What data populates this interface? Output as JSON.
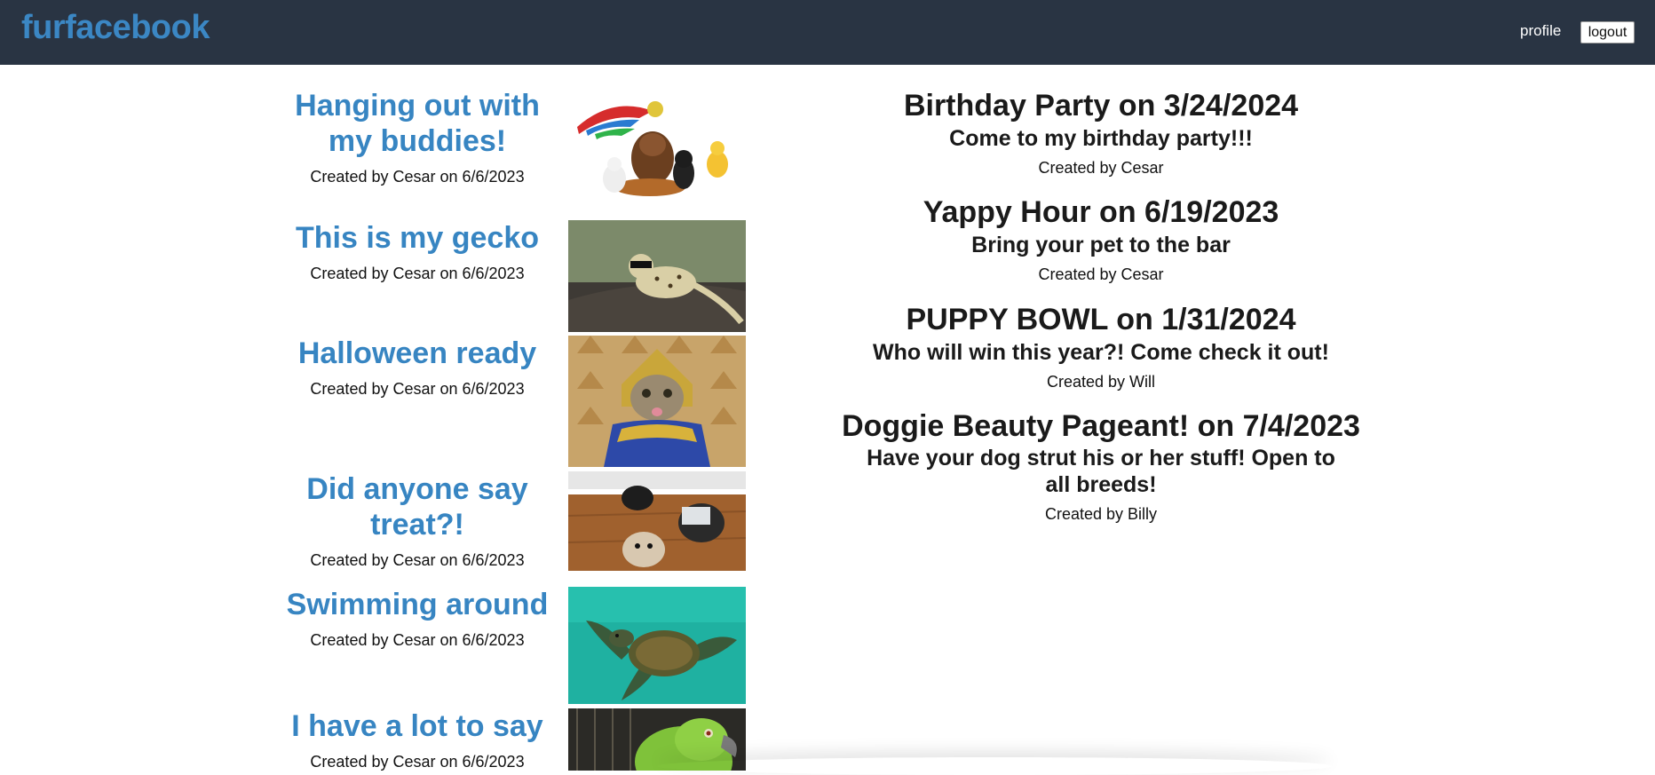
{
  "navbar": {
    "brand": "furfacebook",
    "profile_label": "profile",
    "logout_label": "logout"
  },
  "posts": [
    {
      "title": "Hanging out with my buddies!",
      "meta": "Created by Cesar on 6/6/2023",
      "image": "pets-group"
    },
    {
      "title": "This is my gecko",
      "meta": "Created by Cesar on 6/6/2023",
      "image": "gecko"
    },
    {
      "title": "Halloween ready",
      "meta": "Created by Cesar on 6/6/2023",
      "image": "cat-pharaoh"
    },
    {
      "title": "Did anyone say treat?!",
      "meta": "Created by Cesar on 6/6/2023",
      "image": "dogs-treat"
    },
    {
      "title": "Swimming around",
      "meta": "Created by Cesar on 6/6/2023",
      "image": "sea-turtle"
    },
    {
      "title": "I have a lot to say",
      "meta": "Created by Cesar on 6/6/2023",
      "image": "parrot"
    }
  ],
  "events": [
    {
      "title": "Birthday Party on 3/24/2024",
      "description": "Come to my birthday party!!!",
      "meta": "Created by Cesar"
    },
    {
      "title": "Yappy Hour on 6/19/2023",
      "description": "Bring your pet to the bar",
      "meta": "Created by Cesar"
    },
    {
      "title": "PUPPY BOWL on 1/31/2024",
      "description": "Who will win this year?! Come check it out!",
      "meta": "Created by Will"
    },
    {
      "title": "Doggie Beauty Pageant! on 7/4/2023",
      "description": "Have your dog strut his or her stuff! Open to all breeds!",
      "meta": "Created by Billy"
    }
  ],
  "colors": {
    "navbar_bg": "#293443",
    "brand": "#3b87c4",
    "post_title": "#3785c2"
  }
}
